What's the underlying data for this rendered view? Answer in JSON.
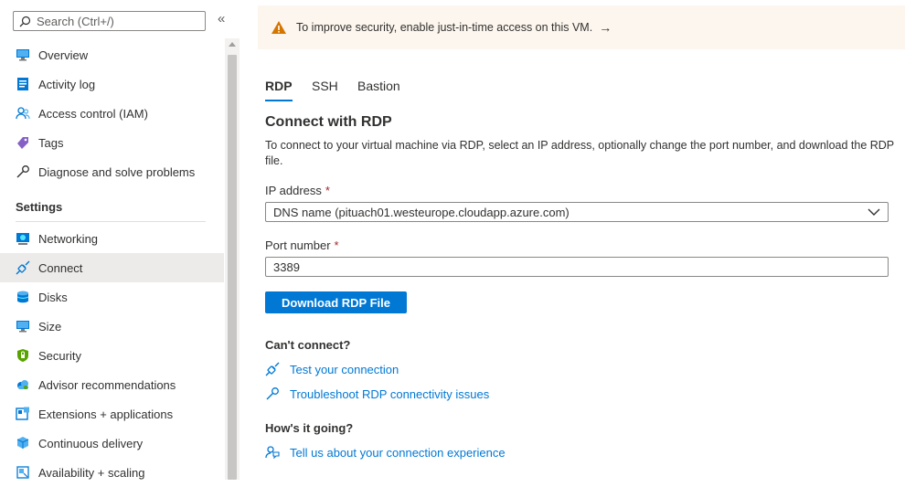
{
  "sidebar": {
    "search_placeholder": "Search (Ctrl+/)",
    "collapse_icon": "«",
    "items_top": [
      {
        "label": "Overview",
        "icon": "monitor-icon"
      },
      {
        "label": "Activity log",
        "icon": "log-icon"
      },
      {
        "label": "Access control (IAM)",
        "icon": "people-icon"
      },
      {
        "label": "Tags",
        "icon": "tag-icon"
      },
      {
        "label": "Diagnose and solve problems",
        "icon": "wrench-icon"
      }
    ],
    "section_label": "Settings",
    "items_settings": [
      {
        "label": "Networking",
        "icon": "network-icon"
      },
      {
        "label": "Connect",
        "icon": "plug-icon",
        "active": true
      },
      {
        "label": "Disks",
        "icon": "disk-icon"
      },
      {
        "label": "Size",
        "icon": "monitor-icon"
      },
      {
        "label": "Security",
        "icon": "shield-icon"
      },
      {
        "label": "Advisor recommendations",
        "icon": "cloud-icon"
      },
      {
        "label": "Extensions + applications",
        "icon": "extension-icon"
      },
      {
        "label": "Continuous delivery",
        "icon": "cube-icon"
      },
      {
        "label": "Availability + scaling",
        "icon": "scaling-icon"
      }
    ]
  },
  "banner": {
    "text": "To improve security, enable just-in-time access on this VM.",
    "arrow": "→"
  },
  "tabs": [
    {
      "label": "RDP",
      "active": true
    },
    {
      "label": "SSH"
    },
    {
      "label": "Bastion"
    }
  ],
  "connect": {
    "heading": "Connect with RDP",
    "description": "To connect to your virtual machine via RDP, select an IP address, optionally change the port number, and download the RDP file.",
    "ip_label": "IP address",
    "ip_value": "DNS name (pituach01.westeurope.cloudapp.azure.com)",
    "port_label": "Port number",
    "port_value": "3389",
    "required_mark": "*",
    "download_label": "Download RDP File"
  },
  "cant_connect": {
    "heading": "Can't connect?",
    "links": [
      "Test your connection",
      "Troubleshoot RDP connectivity issues"
    ]
  },
  "feedback": {
    "heading": "How's it going?",
    "link": "Tell us about your connection experience"
  },
  "colors": {
    "accent": "#0078d4",
    "warning": "#d47500",
    "required": "#a4262c"
  }
}
